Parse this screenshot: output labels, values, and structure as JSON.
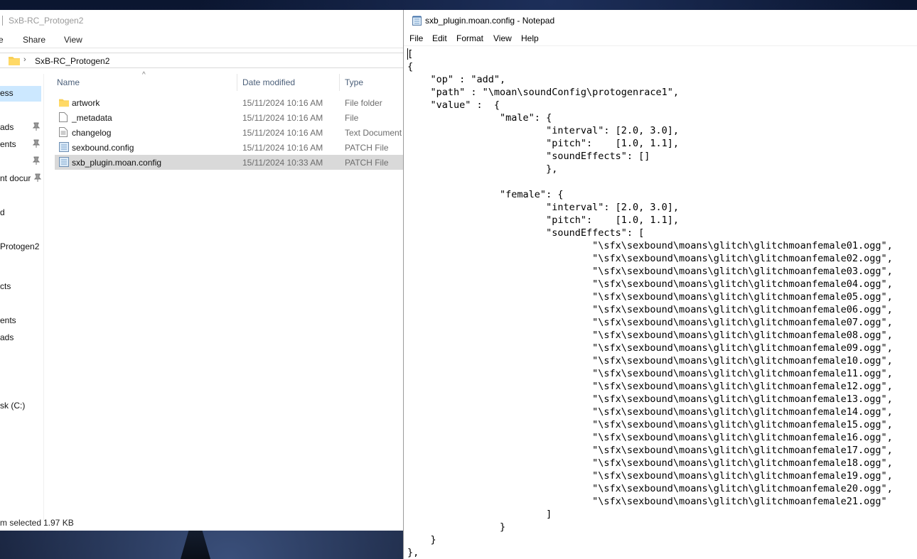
{
  "explorer": {
    "title": "SxB-RC_Protogen2",
    "ribbon_tabs": [
      "e",
      "Share",
      "View"
    ],
    "address_crumb": "SxB-RC_Protogen2",
    "nav_items": [
      {
        "label": "ess",
        "pinned": false,
        "selected": true
      },
      {
        "label": "ads",
        "pinned": true,
        "selected": false
      },
      {
        "label": "ents",
        "pinned": true,
        "selected": false
      },
      {
        "label": "",
        "pinned": true,
        "selected": false
      },
      {
        "label": "nt docur",
        "pinned": true,
        "selected": false
      },
      {
        "label": "d",
        "pinned": false,
        "selected": false
      },
      {
        "label": "Protogen2",
        "pinned": false,
        "selected": false
      },
      {
        "label": "cts",
        "pinned": false,
        "selected": false
      },
      {
        "label": "ents",
        "pinned": false,
        "selected": false
      },
      {
        "label": "ads",
        "pinned": false,
        "selected": false
      },
      {
        "label": "sk (C:)",
        "pinned": false,
        "selected": false
      }
    ],
    "columns": {
      "name": "Name",
      "date": "Date modified",
      "type": "Type"
    },
    "files": [
      {
        "name": "artwork",
        "date": "15/11/2024 10:16 AM",
        "type": "File folder",
        "icon": "folder-icon",
        "selected": false
      },
      {
        "name": "_metadata",
        "date": "15/11/2024 10:16 AM",
        "type": "File",
        "icon": "file-icon",
        "selected": false
      },
      {
        "name": "changelog",
        "date": "15/11/2024 10:16 AM",
        "type": "Text Document",
        "icon": "text-file-icon",
        "selected": false
      },
      {
        "name": "sexbound.config",
        "date": "15/11/2024 10:16 AM",
        "type": "PATCH File",
        "icon": "patch-file-icon",
        "selected": false
      },
      {
        "name": "sxb_plugin.moan.config",
        "date": "15/11/2024 10:33 AM",
        "type": "PATCH File",
        "icon": "patch-file-icon",
        "selected": true
      }
    ],
    "status": {
      "items": "m selected",
      "size": "1.97 KB"
    }
  },
  "notepad": {
    "title": "sxb_plugin.moan.config - Notepad",
    "menu": [
      "File",
      "Edit",
      "Format",
      "View",
      "Help"
    ],
    "lines": [
      "[",
      "{",
      "    \"op\" : \"add\",",
      "    \"path\" : \"\\moan\\soundConfig\\protogenrace1\",",
      "    \"value\" :  {",
      "                \"male\": {",
      "                        \"interval\": [2.0, 3.0],",
      "                        \"pitch\":    [1.0, 1.1],",
      "                        \"soundEffects\": []",
      "                        },",
      "",
      "                \"female\": {",
      "                        \"interval\": [2.0, 3.0],",
      "                        \"pitch\":    [1.0, 1.1],",
      "                        \"soundEffects\": [",
      "                                \"\\sfx\\sexbound\\moans\\glitch\\glitchmoanfemale01.ogg\",",
      "                                \"\\sfx\\sexbound\\moans\\glitch\\glitchmoanfemale02.ogg\",",
      "                                \"\\sfx\\sexbound\\moans\\glitch\\glitchmoanfemale03.ogg\",",
      "                                \"\\sfx\\sexbound\\moans\\glitch\\glitchmoanfemale04.ogg\",",
      "                                \"\\sfx\\sexbound\\moans\\glitch\\glitchmoanfemale05.ogg\",",
      "                                \"\\sfx\\sexbound\\moans\\glitch\\glitchmoanfemale06.ogg\",",
      "                                \"\\sfx\\sexbound\\moans\\glitch\\glitchmoanfemale07.ogg\",",
      "                                \"\\sfx\\sexbound\\moans\\glitch\\glitchmoanfemale08.ogg\",",
      "                                \"\\sfx\\sexbound\\moans\\glitch\\glitchmoanfemale09.ogg\",",
      "                                \"\\sfx\\sexbound\\moans\\glitch\\glitchmoanfemale10.ogg\",",
      "                                \"\\sfx\\sexbound\\moans\\glitch\\glitchmoanfemale11.ogg\",",
      "                                \"\\sfx\\sexbound\\moans\\glitch\\glitchmoanfemale12.ogg\",",
      "                                \"\\sfx\\sexbound\\moans\\glitch\\glitchmoanfemale13.ogg\",",
      "                                \"\\sfx\\sexbound\\moans\\glitch\\glitchmoanfemale14.ogg\",",
      "                                \"\\sfx\\sexbound\\moans\\glitch\\glitchmoanfemale15.ogg\",",
      "                                \"\\sfx\\sexbound\\moans\\glitch\\glitchmoanfemale16.ogg\",",
      "                                \"\\sfx\\sexbound\\moans\\glitch\\glitchmoanfemale17.ogg\",",
      "                                \"\\sfx\\sexbound\\moans\\glitch\\glitchmoanfemale18.ogg\",",
      "                                \"\\sfx\\sexbound\\moans\\glitch\\glitchmoanfemale19.ogg\",",
      "                                \"\\sfx\\sexbound\\moans\\glitch\\glitchmoanfemale20.ogg\",",
      "                                \"\\sfx\\sexbound\\moans\\glitch\\glitchmoanfemale21.ogg\"",
      "                        ]",
      "                }",
      "    }",
      "},"
    ]
  }
}
